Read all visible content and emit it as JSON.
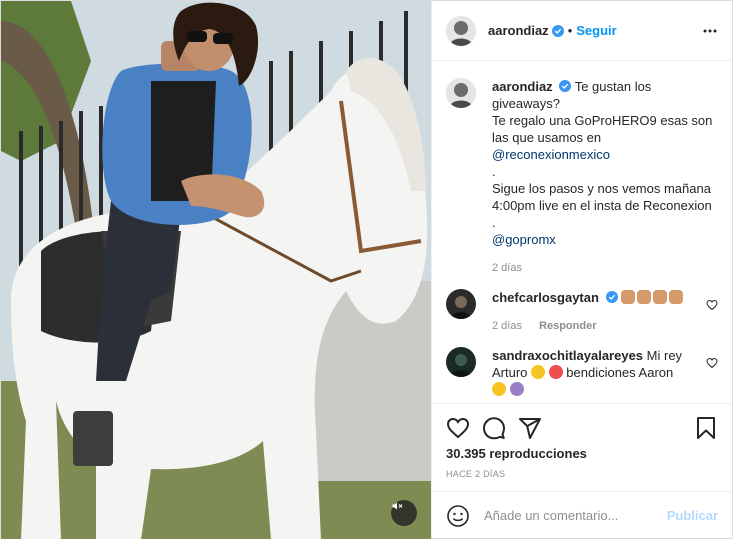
{
  "header": {
    "username": "aarondiaz",
    "separator": "•",
    "follow_label": "Seguir"
  },
  "caption": {
    "username": "aarondiaz",
    "line1": "Te gustan los giveaways?",
    "line2": "Te regalo una GoProHERO9 esas son",
    "line3": "las que usamos en",
    "mention1": "@reconexionmexico",
    "dot1": ".",
    "line4": "Sigue los pasos y nos vemos mañana",
    "line5": "4:00pm live en el insta de Reconexion",
    "dot2": ".",
    "mention2": "@gopromx",
    "time": "2 días"
  },
  "comments": [
    {
      "username": "chefcarlosgaytan",
      "time": "2 días",
      "reply_label": "Responder"
    },
    {
      "username": "sandraxochitlayalareyes",
      "text1": "Mi rey",
      "text2": "Arturo",
      "text3": "bendiciones Aaron"
    }
  ],
  "stats": {
    "views": "30.395 reproducciones",
    "posted": "HACE 2 DÍAS"
  },
  "comment_box": {
    "placeholder": "Añade un comentario...",
    "post_label": "Publicar"
  },
  "colors": {
    "accent": "#0095f6",
    "verified": "#3897f0",
    "post_disabled": "#b3dbff"
  },
  "icons": [
    "more-icon",
    "verified-icon",
    "heart-icon",
    "comment-icon",
    "share-icon",
    "bookmark-icon",
    "emoji-icon",
    "mute-icon"
  ]
}
